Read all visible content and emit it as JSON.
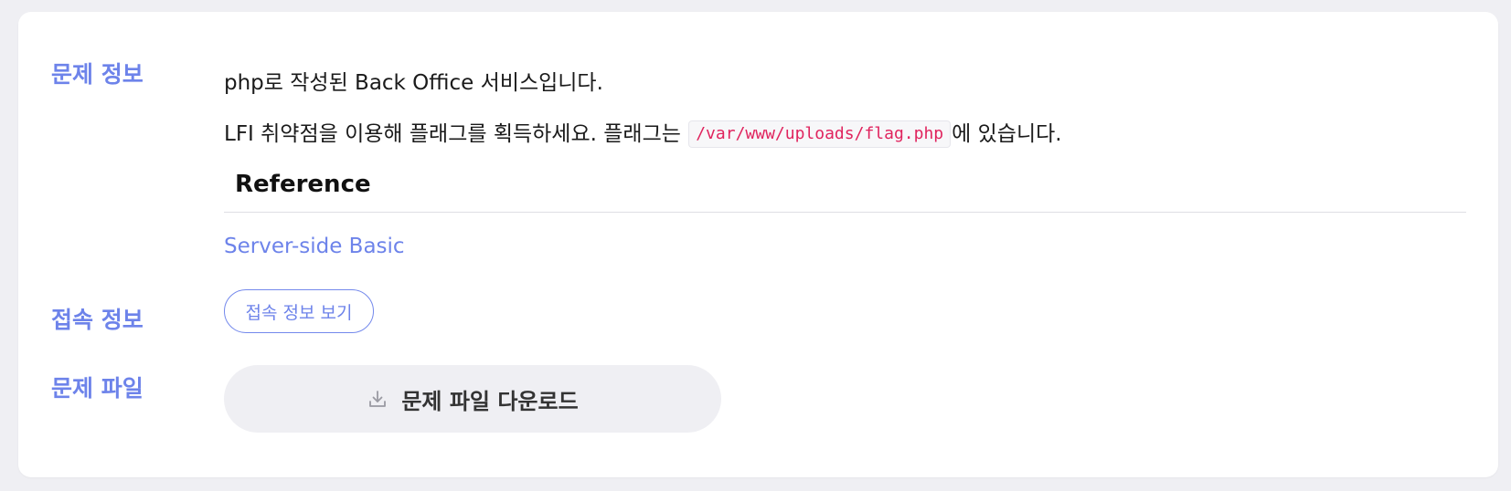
{
  "challenge": {
    "info_label": "문제 정보",
    "description_line1": "php로 작성된 Back Office 서비스입니다.",
    "description_line2_before": "LFI 취약점을 이용해 플래그를 획득하세요. 플래그는 ",
    "flag_path": "/var/www/uploads/flag.php",
    "description_line2_after": "에 있습니다.",
    "reference_heading": "Reference",
    "reference_link": "Server-side Basic"
  },
  "access": {
    "label": "접속 정보",
    "button_label": "접속 정보 보기"
  },
  "files": {
    "label": "문제 파일",
    "download_label": "문제 파일 다운로드",
    "download_icon": "download-icon"
  },
  "colors": {
    "accent": "#6d83ea",
    "code_text": "#e0245e",
    "page_background": "#efeff3"
  }
}
